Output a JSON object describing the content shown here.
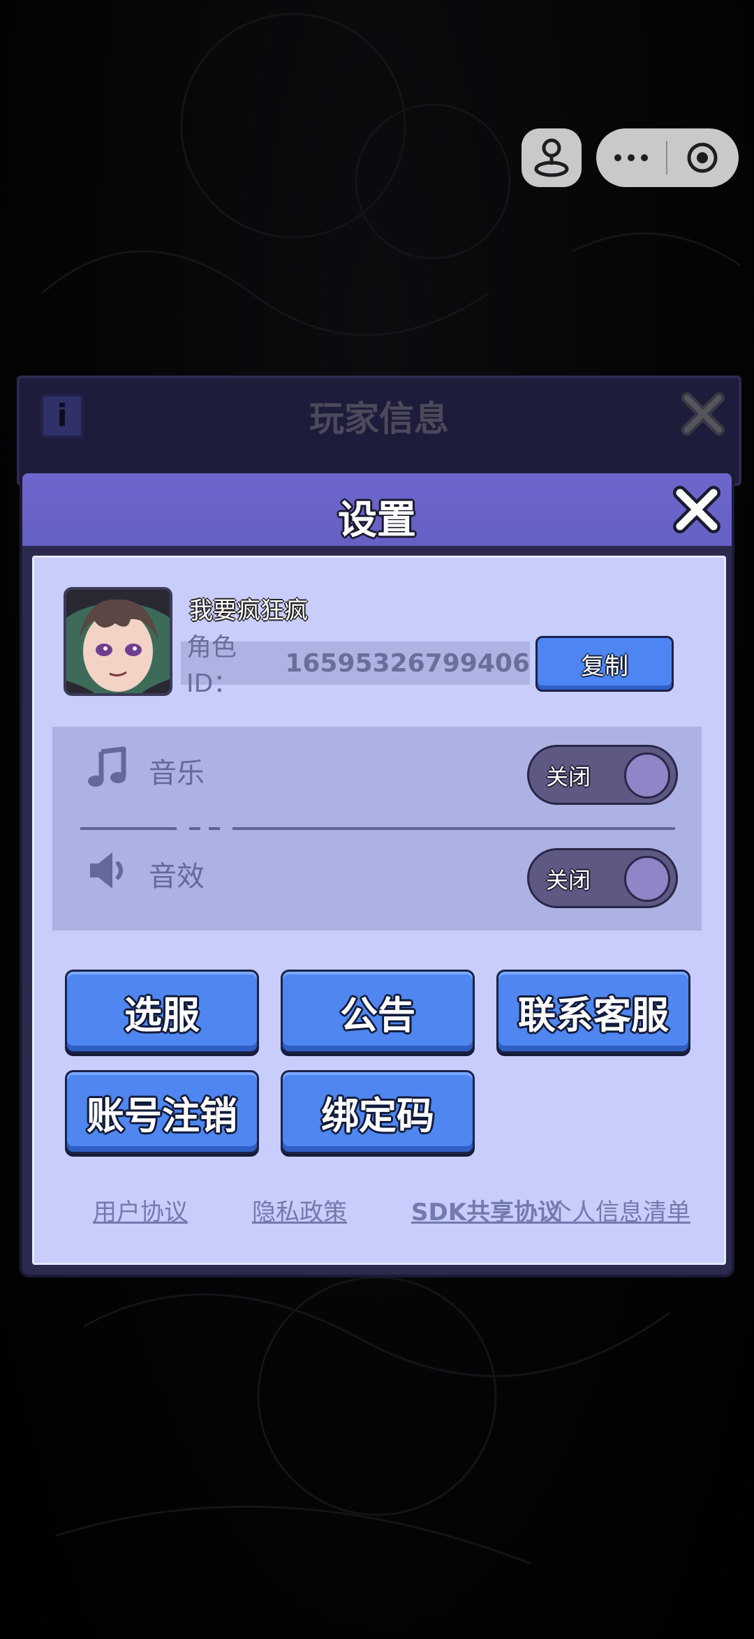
{
  "capsule": {
    "user_icon": "joystick-icon",
    "more_icon": "more-dots-icon",
    "close_icon": "target-circle-icon"
  },
  "background_dialog": {
    "title": "玩家信息",
    "info_icon_label": "i"
  },
  "settings_dialog": {
    "title": "设置",
    "profile": {
      "nickname": "我要疯狂疯",
      "role_id_label": "角色ID：",
      "role_id_value": "16595326799406",
      "copy_label": "复制"
    },
    "toggles": [
      {
        "icon": "music-note-icon",
        "label": "音乐",
        "state_label": "关闭"
      },
      {
        "icon": "speaker-icon",
        "label": "音效",
        "state_label": "关闭"
      }
    ],
    "buttons": {
      "server_select": "选服",
      "announcement": "公告",
      "contact_support": "联系客服",
      "account_cancel": "账号注销",
      "bind_code": "绑定码"
    },
    "links": {
      "user_agreement": "用户协议",
      "privacy_policy": "隐私政策",
      "sdk_sharing": "SDK共享协议",
      "personal_info_list": "个人信息清单"
    }
  },
  "colors": {
    "header": "#6e66cc",
    "body": "#c8cdfb",
    "button": "#4f86f0",
    "panel": "#acb2e4"
  }
}
